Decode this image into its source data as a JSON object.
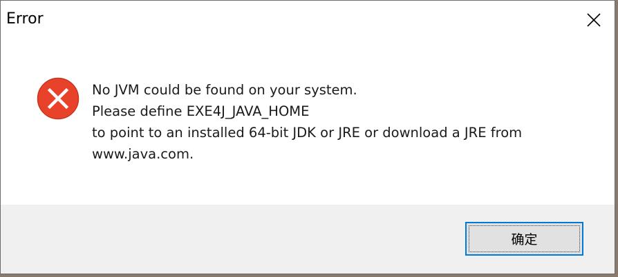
{
  "window": {
    "title": "Error",
    "close_icon": "close-icon"
  },
  "dialog": {
    "icon": "error-icon",
    "icon_color": "#e8432a",
    "message_lines": [
      "No JVM could be found on your system.",
      "Please define EXE4J_JAVA_HOME",
      "to point to an installed 64-bit JDK or JRE or download a JRE from",
      "www.java.com."
    ]
  },
  "buttons": {
    "ok_label": "确定",
    "focus_color": "#0078d7"
  }
}
